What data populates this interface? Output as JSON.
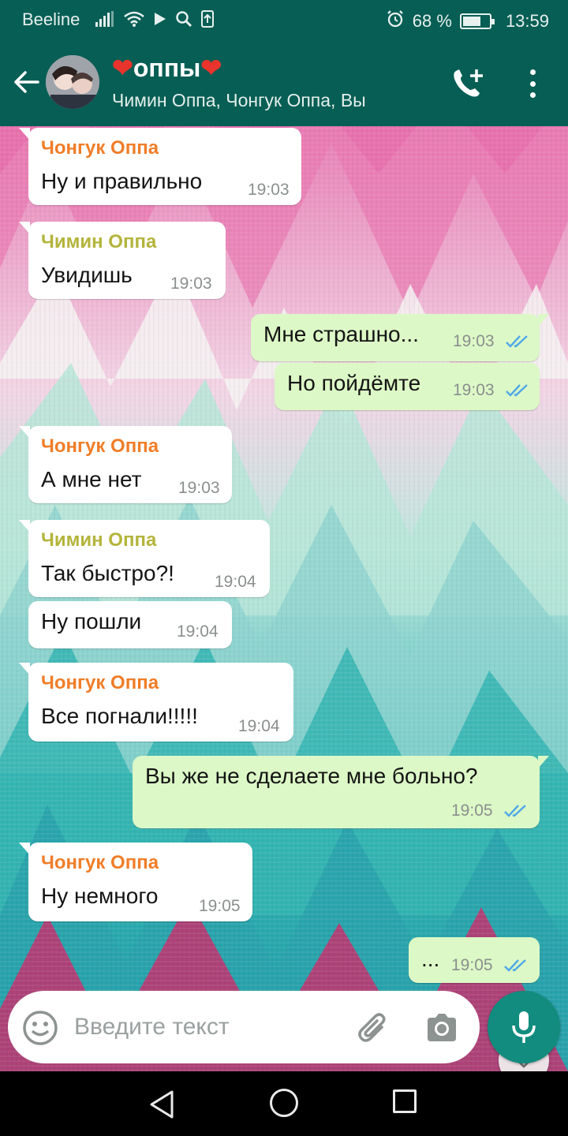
{
  "status_bar": {
    "carrier": "Beeline",
    "battery_text": "68 %",
    "battery_level": 0.68,
    "time": "13:59",
    "icons": [
      "signal-icon",
      "wifi-icon",
      "play-icon",
      "search-icon",
      "download-icon",
      "alarm-icon",
      "battery-icon"
    ]
  },
  "header": {
    "title": "оппы",
    "title_emoji": "❤",
    "subtitle": "Чимин Оппа, Чонгук Оппа, Вы"
  },
  "colors": {
    "header_bg": "#075e54",
    "incoming_bubble": "#ffffff",
    "outgoing_bubble": "#dcf8c6",
    "sender_chonguk": "#f07d28",
    "sender_chimin": "#b4b43c",
    "read_ticks": "#4fa8e8",
    "mic_button": "#128c7e"
  },
  "messages": [
    {
      "dir": "in",
      "sender": "Чонгук Оппа",
      "sender_color": "#f07d28",
      "text": "Ну и правильно",
      "time": "19:03"
    },
    {
      "dir": "in",
      "sender": "Чимин Оппа",
      "sender_color": "#b4b43c",
      "text": "Увидишь",
      "time": "19:03"
    },
    {
      "dir": "out",
      "text": "Мне страшно...",
      "time": "19:03",
      "status": "read"
    },
    {
      "dir": "out",
      "text": "Но пойдёмте",
      "time": "19:03",
      "status": "read"
    },
    {
      "dir": "in",
      "sender": "Чонгук Оппа",
      "sender_color": "#f07d28",
      "text": "А мне нет",
      "time": "19:03"
    },
    {
      "dir": "in",
      "sender": "Чимин Оппа",
      "sender_color": "#b4b43c",
      "text": "Так быстро?!",
      "time": "19:04"
    },
    {
      "dir": "in",
      "text": "Ну пошли",
      "time": "19:04"
    },
    {
      "dir": "in",
      "sender": "Чонгук Оппа",
      "sender_color": "#f07d28",
      "text": "Все погнали!!!!!",
      "time": "19:04"
    },
    {
      "dir": "out",
      "text": "Вы же не сделаете мне больно?",
      "time": "19:05",
      "status": "read"
    },
    {
      "dir": "in",
      "sender": "Чонгук Оппа",
      "sender_color": "#f07d28",
      "text": "Ну немного",
      "time": "19:05"
    },
    {
      "dir": "out",
      "text": "...",
      "time": "19:05",
      "status": "read"
    }
  ],
  "input": {
    "placeholder": "Введите текст"
  },
  "nav": {
    "icons": [
      "back-icon",
      "home-icon",
      "recent-apps-icon"
    ]
  }
}
